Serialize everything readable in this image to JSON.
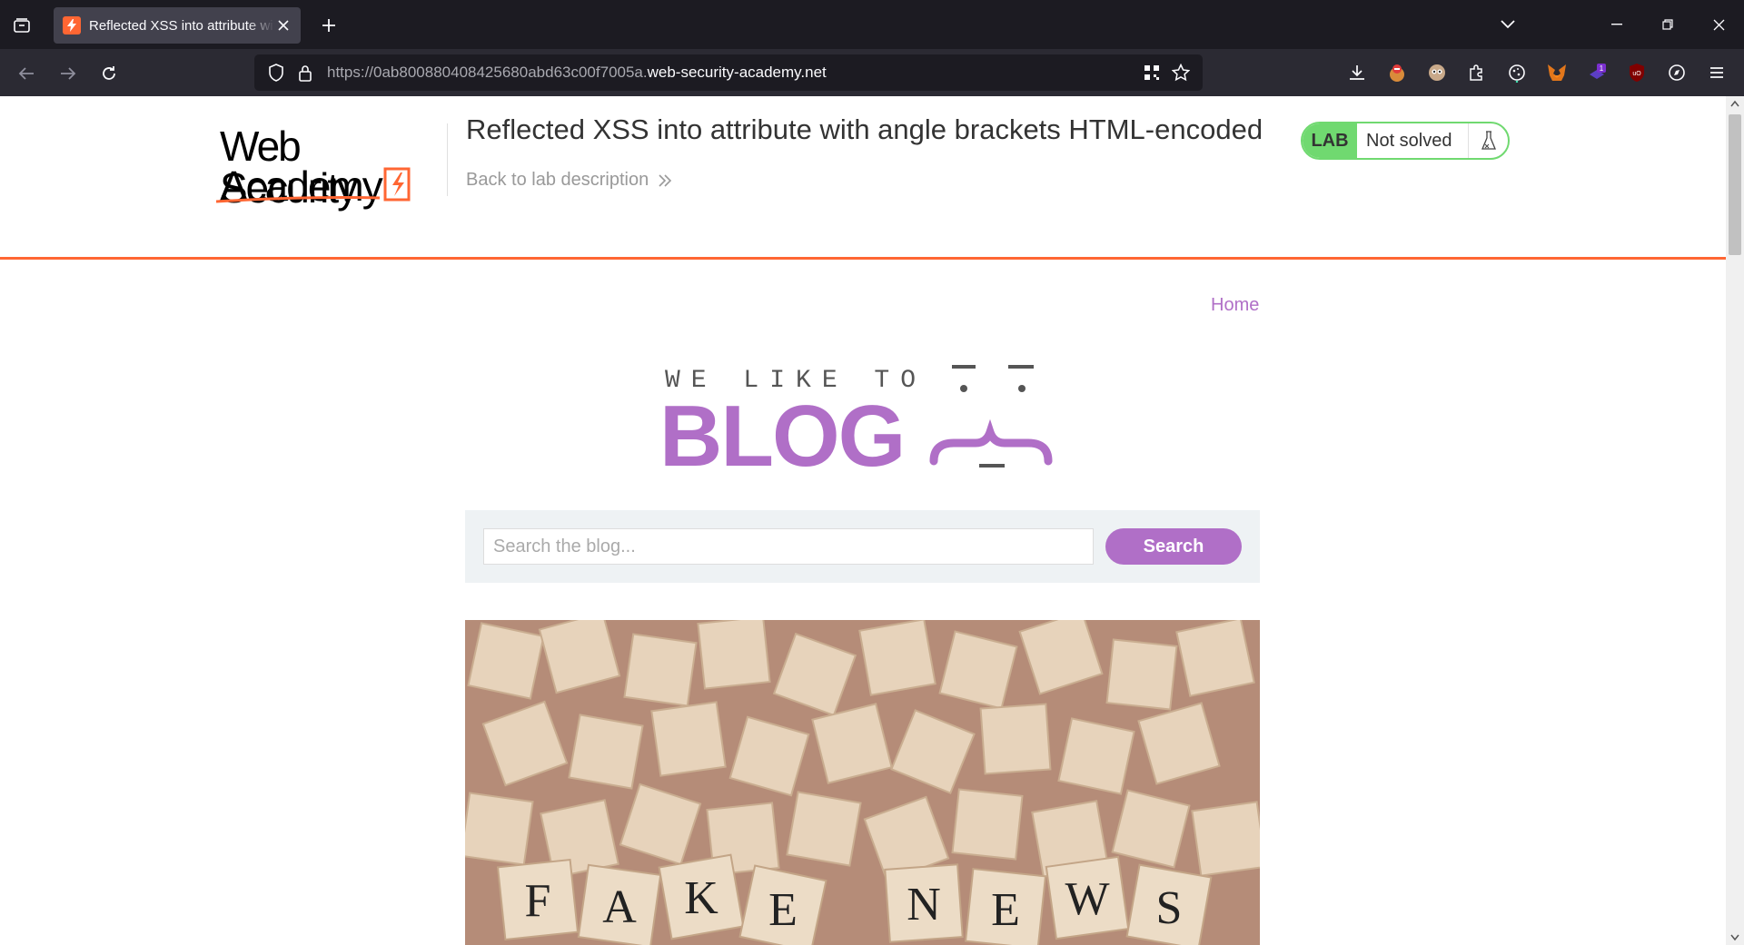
{
  "browser": {
    "tab": {
      "title": "Reflected XSS into attribute with angle brackets HTML-encoded",
      "favicon": "lightning-icon"
    },
    "url": {
      "prefix": "https://0ab800880408425680abd63c00f7005a.",
      "domain": "web-security-academy.net"
    },
    "extension_badge": "1",
    "colors": {
      "chrome_dark": "#1c1b22",
      "chrome_toolbar": "#2b2a33",
      "tab_active": "#42414d"
    }
  },
  "header": {
    "logo_line1": "Web Security",
    "logo_line2": "Academy",
    "lab_title": "Reflected XSS into attribute with angle brackets HTML-encoded",
    "back_link": "Back to lab description",
    "lab_badge": "LAB",
    "lab_status": "Not solved",
    "colors": {
      "accent": "#ff6633",
      "status_green": "#70d970"
    }
  },
  "nav": {
    "home_label": "Home"
  },
  "banner": {
    "small_text": "WE LIKE TO",
    "big_text": "BLOG",
    "color": "#b06fc7"
  },
  "search": {
    "placeholder": "Search the blog...",
    "value": "",
    "button_label": "Search"
  },
  "post": {
    "image_letters": [
      "F",
      "A",
      "K",
      "E",
      "N",
      "E",
      "W",
      "S"
    ]
  }
}
